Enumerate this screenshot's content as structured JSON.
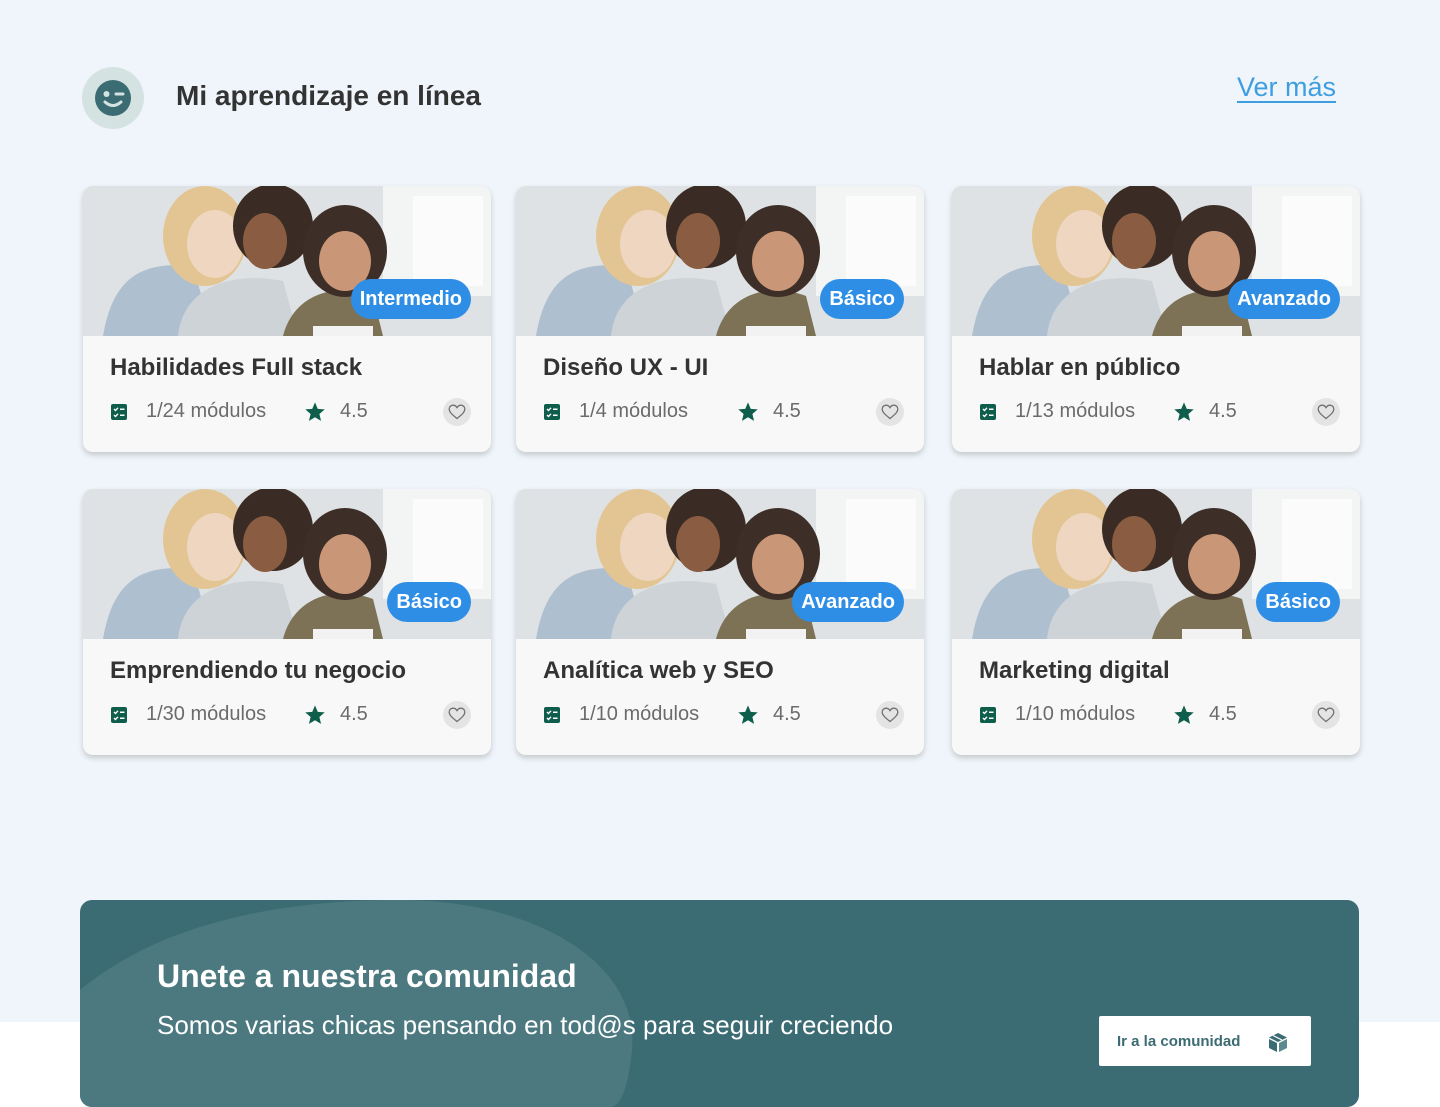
{
  "header": {
    "title": "Mi aprendizaje en línea",
    "see_more": "Ver más",
    "avatar_icon": "wink-face-icon"
  },
  "colors": {
    "background": "#eff5fa",
    "badge": "#2e8ee6",
    "accent_green": "#0f5e4b",
    "link": "#3d9ee0",
    "banner": "#3b6b73"
  },
  "courses": [
    {
      "title": "Habilidades Full stack",
      "level": "Intermedio",
      "modules": "1/24 módulos",
      "rating": "4.5"
    },
    {
      "title": "Diseño UX - UI",
      "level": "Básico",
      "modules": "1/4 módulos",
      "rating": "4.5"
    },
    {
      "title": "Hablar en público",
      "level": "Avanzado",
      "modules": "1/13 módulos",
      "rating": "4.5"
    },
    {
      "title": "Emprendiendo tu negocio",
      "level": "Básico",
      "modules": "1/30 módulos",
      "rating": "4.5"
    },
    {
      "title": "Analítica web y SEO",
      "level": "Avanzado",
      "modules": "1/10 módulos",
      "rating": "4.5"
    },
    {
      "title": "Marketing digital",
      "level": "Básico",
      "modules": "1/10 módulos",
      "rating": "4.5"
    }
  ],
  "community": {
    "title": "Unete a nuestra comunidad",
    "subtitle": "Somos varias chicas pensando en tod@s para seguir creciendo",
    "button_label": "Ir a la comunidad",
    "button_icon": "cube-icon"
  }
}
